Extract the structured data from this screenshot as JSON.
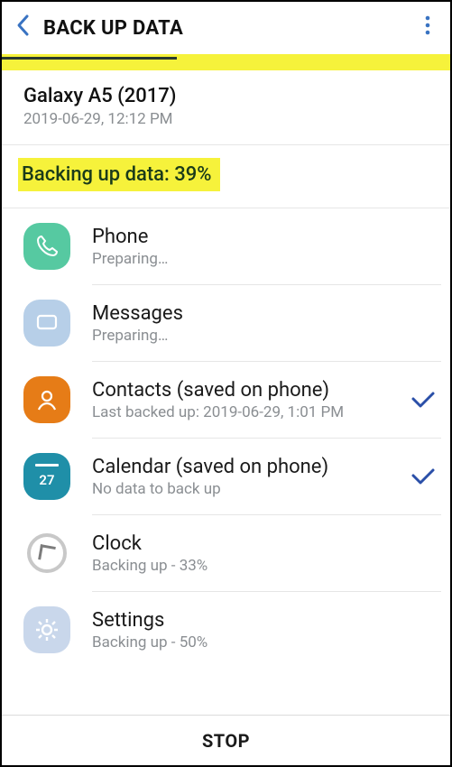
{
  "header": {
    "title": "BACK UP DATA"
  },
  "device": {
    "name": "Galaxy A5 (2017)",
    "timestamp": "2019-06-29, 12:12 PM"
  },
  "status": {
    "text": "Backing up data: 39%"
  },
  "items": [
    {
      "icon": "phone",
      "title": "Phone",
      "sub": "Preparing…",
      "done": false
    },
    {
      "icon": "messages",
      "title": "Messages",
      "sub": "Preparing…",
      "done": false
    },
    {
      "icon": "contacts",
      "title": "Contacts (saved on phone)",
      "sub": "Last backed up: 2019-06-29, 1:01 PM",
      "done": true
    },
    {
      "icon": "calendar",
      "title": "Calendar (saved on phone)",
      "sub": "No data to back up",
      "done": true
    },
    {
      "icon": "clock",
      "title": "Clock",
      "sub": "Backing up - 33%",
      "done": false
    },
    {
      "icon": "settings",
      "title": "Settings",
      "sub": "Backing up - 50%",
      "done": false
    }
  ],
  "footer": {
    "stop_label": "STOP"
  },
  "calendar_day": "27"
}
